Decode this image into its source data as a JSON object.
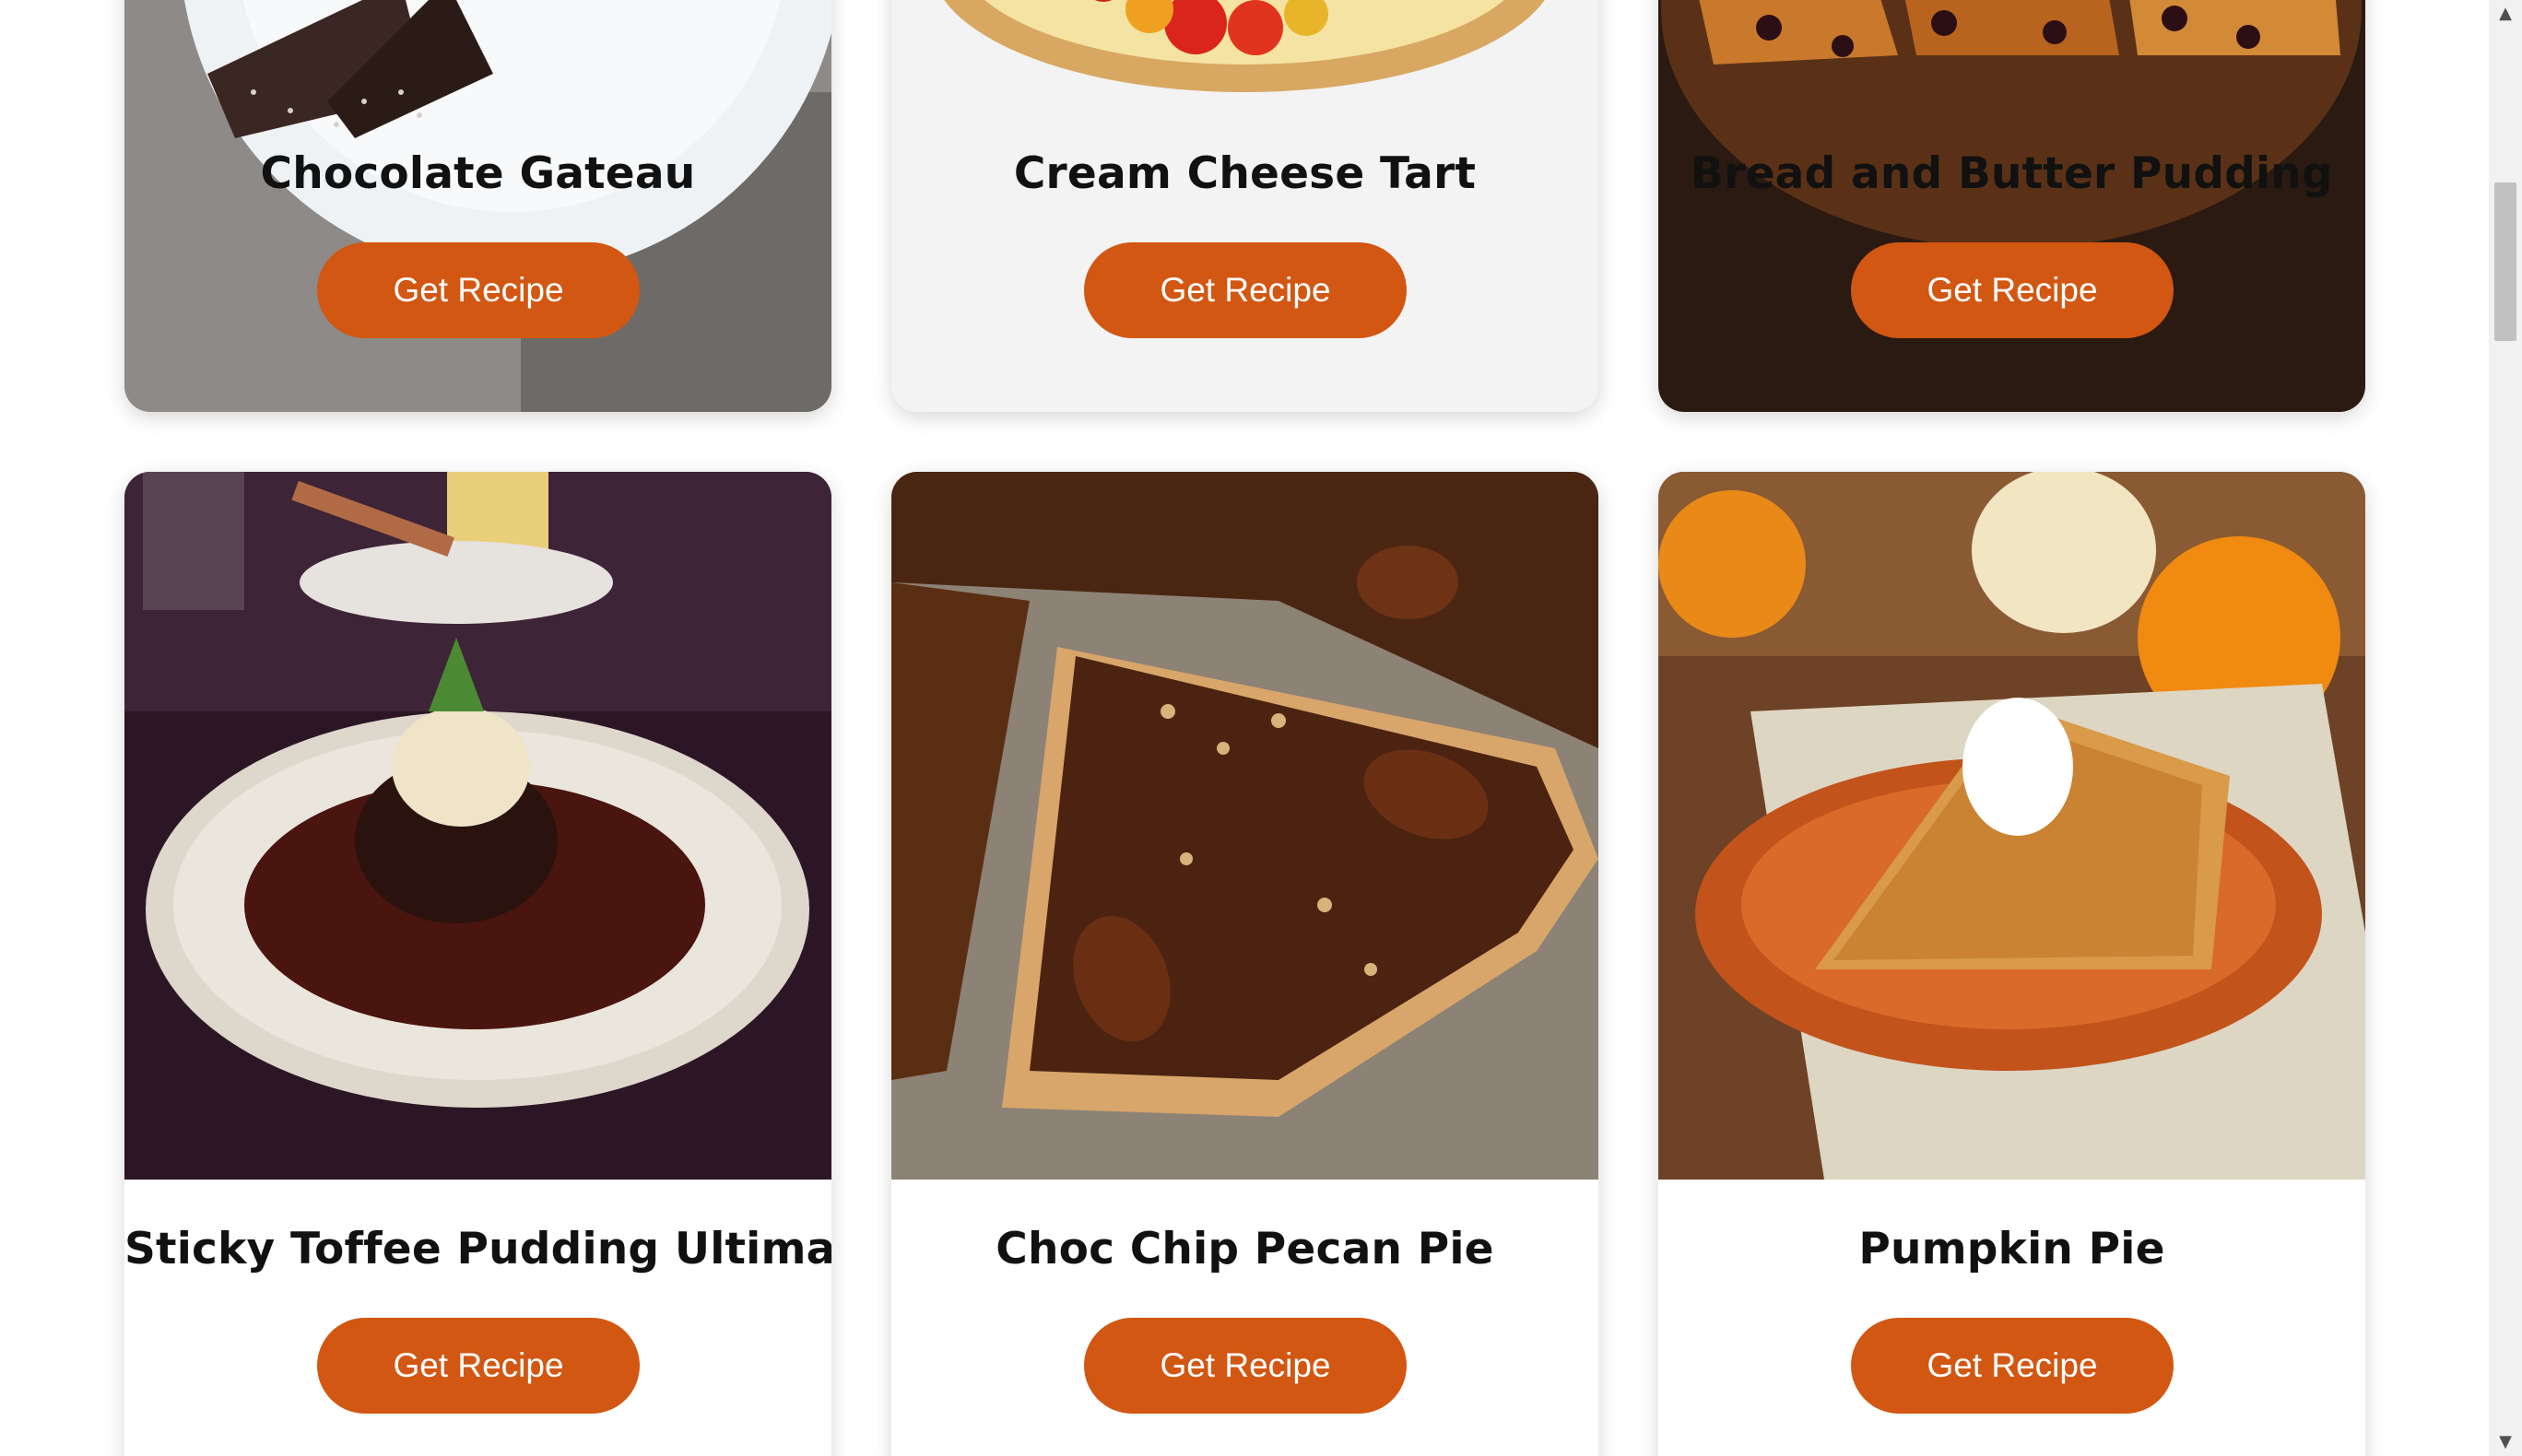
{
  "recipes": [
    {
      "title": "Chocolate Gateau",
      "button_label": "Get Recipe",
      "image": "chocolate-gateau-photo"
    },
    {
      "title": "Cream Cheese Tart",
      "button_label": "Get Recipe",
      "image": "cream-cheese-tart-photo"
    },
    {
      "title": "Bread and Butter Pudding",
      "button_label": "Get Recipe",
      "image": "bread-and-butter-pudding-photo"
    },
    {
      "title": "Sticky Toffee Pudding Ultimate",
      "button_label": "Get Recipe",
      "image": "sticky-toffee-pudding-photo"
    },
    {
      "title": "Choc Chip Pecan Pie",
      "button_label": "Get Recipe",
      "image": "pecan-pie-photo"
    },
    {
      "title": "Pumpkin Pie",
      "button_label": "Get Recipe",
      "image": "pumpkin-pie-photo"
    }
  ],
  "colors": {
    "button": "#d25712",
    "button_text": "#ffffff",
    "title_text": "#111111",
    "background": "#ffffff"
  },
  "scrollbar": {
    "up_icon": "triangle-up-icon",
    "down_icon": "triangle-down-icon"
  }
}
